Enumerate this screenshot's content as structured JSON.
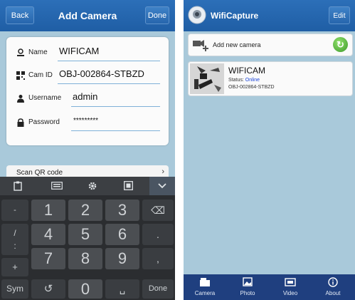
{
  "left": {
    "header": {
      "back_label": "Back",
      "title": "Add Camera",
      "done_label": "Done"
    },
    "form": {
      "name": {
        "label": "Name",
        "value": "WIFICAM"
      },
      "cam_id": {
        "label": "Cam ID",
        "value": "OBJ-002864-STBZD"
      },
      "username": {
        "label": "Username",
        "value": "admin"
      },
      "password": {
        "label": "Password",
        "value": "*********"
      }
    },
    "scan": {
      "label": "Scan QR code",
      "chevron": "›"
    },
    "keyboard": {
      "toolbar": [
        "clipboard-icon",
        "keyboard-icon",
        "settings-icon",
        "emoji-icon",
        "collapse-chevron-icon"
      ],
      "rows": [
        [
          "-",
          "1",
          "2",
          "3",
          "⌫"
        ],
        [
          "/",
          "4",
          "5",
          "6",
          "."
        ],
        [
          ":",
          "",
          "",
          "",
          ""
        ],
        [
          "+",
          "7",
          "8",
          "9",
          ","
        ],
        [
          "Sym",
          "↺",
          "0",
          "␣",
          "Done"
        ]
      ]
    }
  },
  "right": {
    "header": {
      "title": "WifiCapture",
      "edit_label": "Edit"
    },
    "add_camera": {
      "label": "Add new camera"
    },
    "camera": {
      "name": "WIFICAM",
      "status_label": "Status:",
      "status_value": "Online",
      "id": "OBJ-002864-STBZD"
    },
    "tabs": [
      {
        "label": "Camera",
        "icon": "camera-tab-icon"
      },
      {
        "label": "Photo",
        "icon": "photo-tab-icon"
      },
      {
        "label": "Video",
        "icon": "video-tab-icon"
      },
      {
        "label": "About",
        "icon": "info-tab-icon"
      }
    ]
  },
  "colors": {
    "header": "#2c6fb8",
    "background": "#a9c9da",
    "status_online": "#1a44d8",
    "tabbar": "#1f3f7f"
  }
}
